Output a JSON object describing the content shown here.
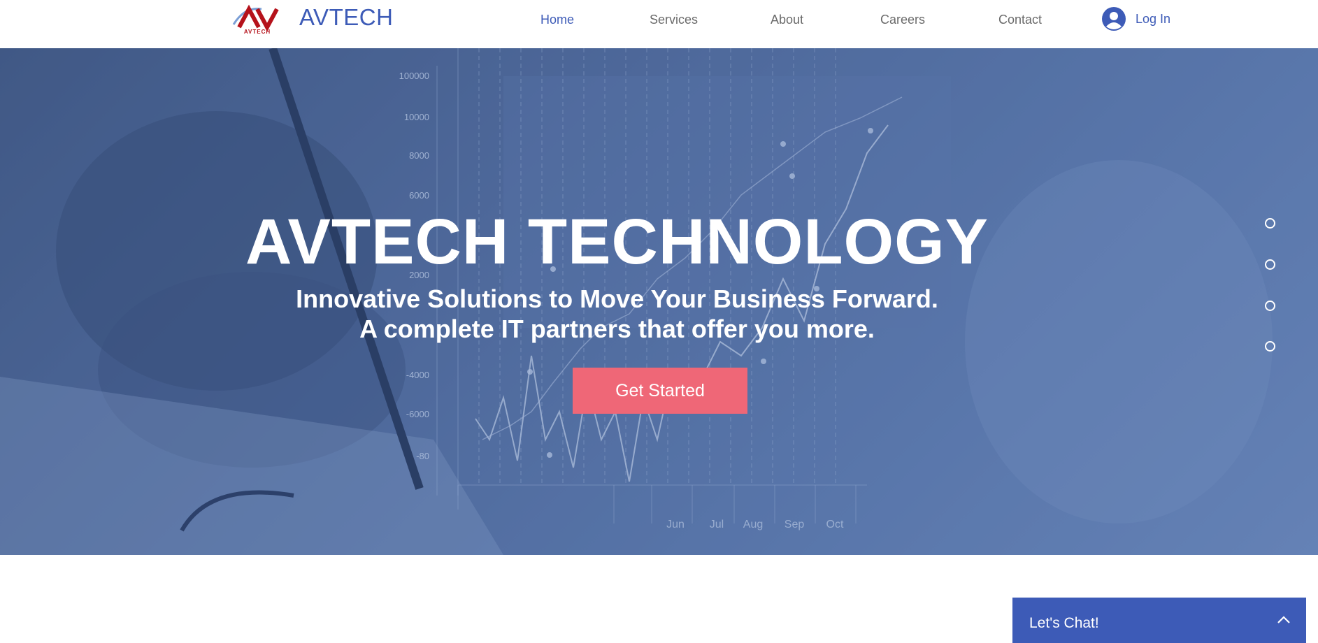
{
  "header": {
    "logo_text": "AVTECH",
    "brand": "AVTECH",
    "nav": [
      {
        "label": "Home",
        "active": true
      },
      {
        "label": "Services",
        "active": false
      },
      {
        "label": "About",
        "active": false
      },
      {
        "label": "Careers",
        "active": false
      },
      {
        "label": "Contact",
        "active": false
      }
    ],
    "login": {
      "label": "Log In",
      "icon": "user-avatar-icon"
    }
  },
  "hero": {
    "title": "AVTECH TECHNOLOGY",
    "subtitle_line1": "Innovative Solutions to Move Your Business Forward.",
    "subtitle_line2": "A complete IT partners that offer you more.",
    "cta_label": "Get Started",
    "background_chart_labels": {
      "y": [
        "100000",
        "10000",
        "8000",
        "6000",
        "2000",
        "-4000",
        "-6000",
        "-80"
      ],
      "x": [
        "Jun",
        "Jul",
        "Aug",
        "Sep",
        "Oct"
      ]
    },
    "slide_dots": 4
  },
  "chat": {
    "label": "Let's Chat!",
    "icon": "chevron-up-icon"
  },
  "colors": {
    "brand_blue": "#3d5bb7",
    "cta_pink": "#ef6777",
    "nav_gray": "#6a6a6a",
    "logo_red": "#b5121b"
  }
}
